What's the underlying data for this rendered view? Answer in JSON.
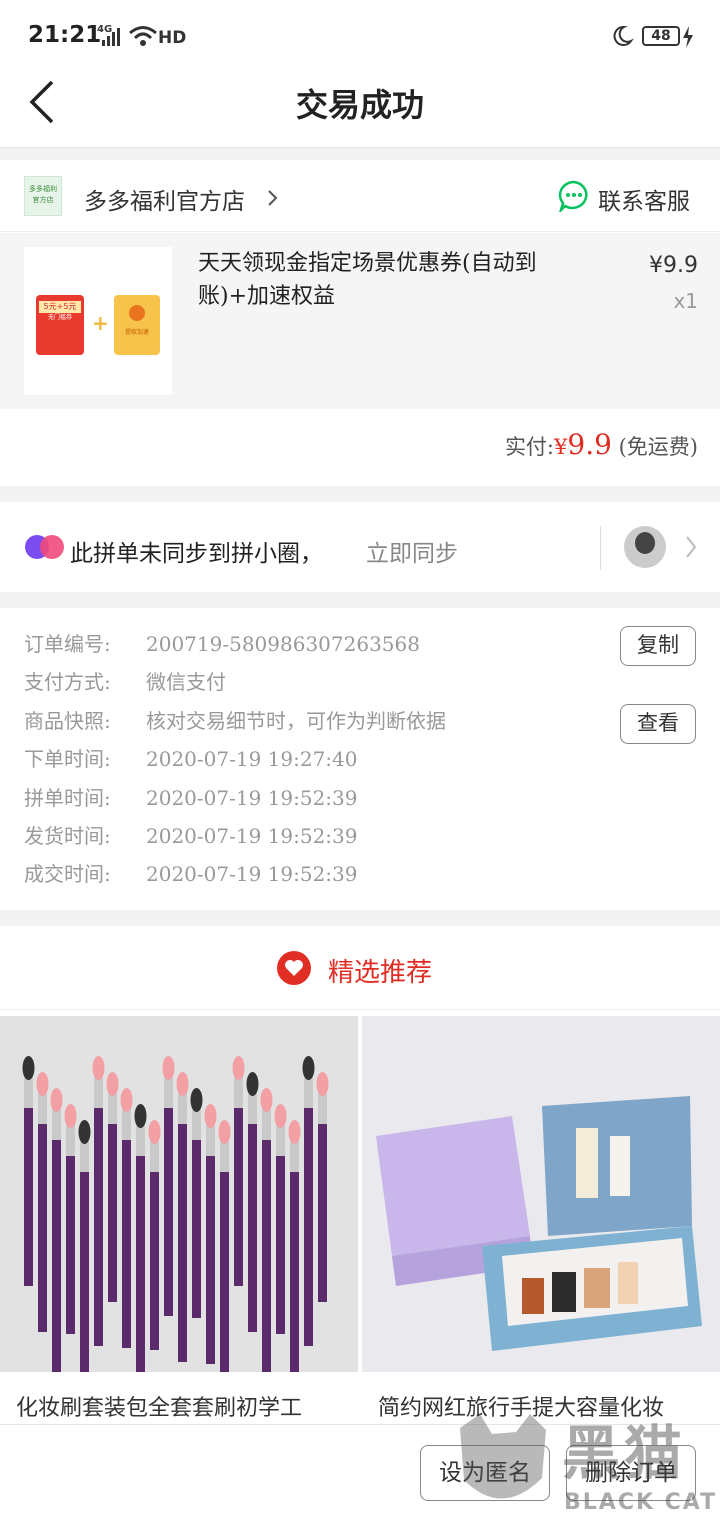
{
  "status": {
    "time": "21:21",
    "network": "4G",
    "hd": "HD",
    "battery": "48"
  },
  "nav": {
    "title": "交易成功"
  },
  "shop": {
    "logo_text": "多多福利\n官方店",
    "name": "多多福利官方店",
    "service": "联系客服"
  },
  "item": {
    "title": "天天领现金指定场景优惠券(自动到账)+加速权益",
    "price": "¥9.9",
    "qty": "x1",
    "thumb": {
      "coupon_text": "5元+5元",
      "coupon_sub": "无门槛券",
      "plus": "+",
      "envelope_sub": "提取加速"
    }
  },
  "payment": {
    "label": "实付:",
    "currency": "¥",
    "amount": "9.9",
    "note": "(免运费)"
  },
  "sync": {
    "text": "此拼单未同步到拼小圈，",
    "link": "立即同步"
  },
  "order": {
    "rows": [
      {
        "label": "订单编号:",
        "value": "200719-580986307263568"
      },
      {
        "label": "支付方式:",
        "value": "微信支付"
      },
      {
        "label": "商品快照:",
        "value": "核对交易细节时，可作为判断依据"
      },
      {
        "label": "下单时间:",
        "value": "2020-07-19 19:27:40"
      },
      {
        "label": "拼单时间:",
        "value": "2020-07-19 19:52:39"
      },
      {
        "label": "发货时间:",
        "value": "2020-07-19 19:52:39"
      },
      {
        "label": "成交时间:",
        "value": "2020-07-19 19:52:39"
      }
    ],
    "copy_btn": "复制",
    "view_btn": "查看"
  },
  "recommend": {
    "title": "精选推荐",
    "products": [
      {
        "title": "化妆刷套装包全套套刷初学工"
      },
      {
        "title": "简约网红旅行手提大容量化妆"
      }
    ]
  },
  "bottom": {
    "anonymous_btn": "设为匿名",
    "delete_btn": "删除订单"
  },
  "watermark": {
    "brand": "黑猫",
    "sub": "BLACK CAT"
  },
  "colors": {
    "accent_red": "#e02e24",
    "wechat_green": "#07c160",
    "text_gray": "#999999"
  }
}
